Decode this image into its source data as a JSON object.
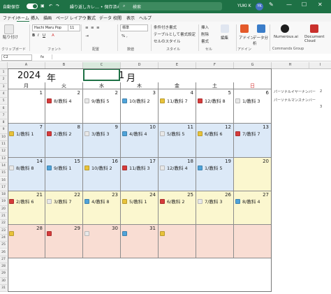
{
  "titlebar": {
    "autosave": "自動保存",
    "autosave_state": "オン",
    "filename": "繰り返しカレ… • 保存済み",
    "search_placeholder": "検索",
    "user": "YUKI K",
    "user_initials": "YK"
  },
  "menu": [
    "ファイル",
    "ホーム",
    "挿入",
    "描画",
    "ページ レイアウト",
    "数式",
    "データ",
    "校閲",
    "表示",
    "ヘルプ"
  ],
  "menu_active_index": 1,
  "ribbon": {
    "paste": "貼り付け",
    "clipboard": "クリップボード",
    "font_name": "Hachi Maru Pop",
    "font_size": "11",
    "font_group": "フォント",
    "align_group": "配置",
    "number_format": "標準",
    "number_group": "数値",
    "cond_format": "条件付き書式",
    "table_format": "テーブルとして書式設定",
    "cell_style": "セルのスタイル",
    "style_group": "スタイル",
    "insert": "挿入",
    "delete": "削除",
    "format": "書式",
    "cells_group": "セル",
    "editing": "編集",
    "addins": "アドイン",
    "addins_group": "アドイン",
    "analyze": "データ分析",
    "numerous": "Numerous.ai",
    "commands_group": "Commands Group",
    "doc_cloud": "Document Cloud"
  },
  "formula": {
    "cell": "C2",
    "fx": "fx"
  },
  "columns": [
    "A",
    "B",
    "C",
    "D",
    "E",
    "F",
    "G",
    "H",
    "I"
  ],
  "rows": [
    "1",
    "2",
    "3",
    "4",
    "5",
    "6",
    "7",
    "8",
    "9",
    "10",
    "11",
    "12",
    "13",
    "14",
    "15",
    "16",
    "17",
    "18",
    "19",
    "20",
    "21",
    "22",
    "23",
    "24",
    "25",
    "26",
    "27",
    "28",
    "29",
    "30",
    "31"
  ],
  "calendar": {
    "year": "2024",
    "year_unit": "年",
    "month": "1",
    "month_unit": "月",
    "weekdays": [
      "月",
      "火",
      "水",
      "木",
      "金",
      "土",
      "日"
    ],
    "weeks": [
      {
        "days": [
          {
            "day": "1",
            "text": ""
          },
          {
            "day": "2",
            "text": "8/教科 4",
            "icon": "#d63b3b"
          },
          {
            "day": "2",
            "text": "9/教科 5",
            "icon": "#e8e8e8"
          },
          {
            "day": "3",
            "text": "10/教科 2",
            "icon": "#4fa3d9"
          },
          {
            "day": "4",
            "text": "11/教科 7",
            "icon": "#e8c23a"
          },
          {
            "day": "5",
            "text": "12/教科 8",
            "icon": "#d63b3b"
          },
          {
            "day": "6",
            "text": "1/教科 3",
            "icon": "#e8e8e8"
          }
        ]
      },
      {
        "days": [
          {
            "day": "7",
            "text": "1/教科 1",
            "icon": "#e8c23a"
          },
          {
            "day": "8",
            "text": "2/教科 2",
            "icon": "#d63b3b"
          },
          {
            "day": "9",
            "text": "3/教科 3",
            "icon": "#e8e8e8"
          },
          {
            "day": "10",
            "text": "4/教科 4",
            "icon": "#4fa3d9"
          },
          {
            "day": "11",
            "text": "5/教科 5",
            "icon": "#e8e8e8"
          },
          {
            "day": "12",
            "text": "6/教科 6",
            "icon": "#e8c23a"
          },
          {
            "day": "13",
            "text": "7/教科 7",
            "icon": "#d63b3b"
          }
        ]
      },
      {
        "days": [
          {
            "day": "14",
            "text": "8/教科 8",
            "icon": "#e8e8e8"
          },
          {
            "day": "15",
            "text": "9/教科 1",
            "icon": "#4fa3d9"
          },
          {
            "day": "16",
            "text": "10/教科 2",
            "icon": "#e8c23a"
          },
          {
            "day": "17",
            "text": "11/教科 3",
            "icon": "#d63b3b"
          },
          {
            "day": "18",
            "text": "12/教科 4",
            "icon": "#e8e8e8"
          },
          {
            "day": "19",
            "text": "1/教科 5",
            "icon": "#4fa3d9"
          },
          {
            "day": "20",
            "text": "",
            "icon": ""
          }
        ]
      },
      {
        "days": [
          {
            "day": "21",
            "text": "2/教科 6",
            "icon": "#d63b3b"
          },
          {
            "day": "22",
            "text": "3/教科 7",
            "icon": "#e8e8e8"
          },
          {
            "day": "23",
            "text": "4/教科 8",
            "icon": "#4fa3d9"
          },
          {
            "day": "24",
            "text": "5/教科 1",
            "icon": "#e8c23a"
          },
          {
            "day": "25",
            "text": "6/教科 2",
            "icon": "#d63b3b"
          },
          {
            "day": "26",
            "text": "7/教科 3",
            "icon": "#e8e8e8"
          },
          {
            "day": "27",
            "text": "8/教科 4",
            "icon": "#4fa3d9"
          }
        ]
      },
      {
        "days": [
          {
            "day": "28",
            "text": "",
            "icon": "#e8c23a"
          },
          {
            "day": "29",
            "text": "",
            "icon": "#d63b3b"
          },
          {
            "day": "30",
            "text": "",
            "icon": "#e8e8e8"
          },
          {
            "day": "31",
            "text": "",
            "icon": "#4fa3d9"
          },
          {
            "day": "",
            "text": "",
            "icon": "#e8c23a"
          },
          {
            "day": "",
            "text": "",
            "icon": ""
          },
          {
            "day": "",
            "text": "",
            "icon": ""
          }
        ]
      }
    ]
  },
  "side_labels": [
    {
      "label": "パーソナルイヤーナンバー",
      "value": "2"
    },
    {
      "label": "パーソナルマンスナンバー",
      "value": "3"
    }
  ],
  "colors": {
    "excel_green": "#1e7145",
    "row_blue": "#dce9f7",
    "row_yellow": "#fbf7cf",
    "row_pink": "#f9ddd3",
    "sunday_red": "#d63b3b"
  }
}
